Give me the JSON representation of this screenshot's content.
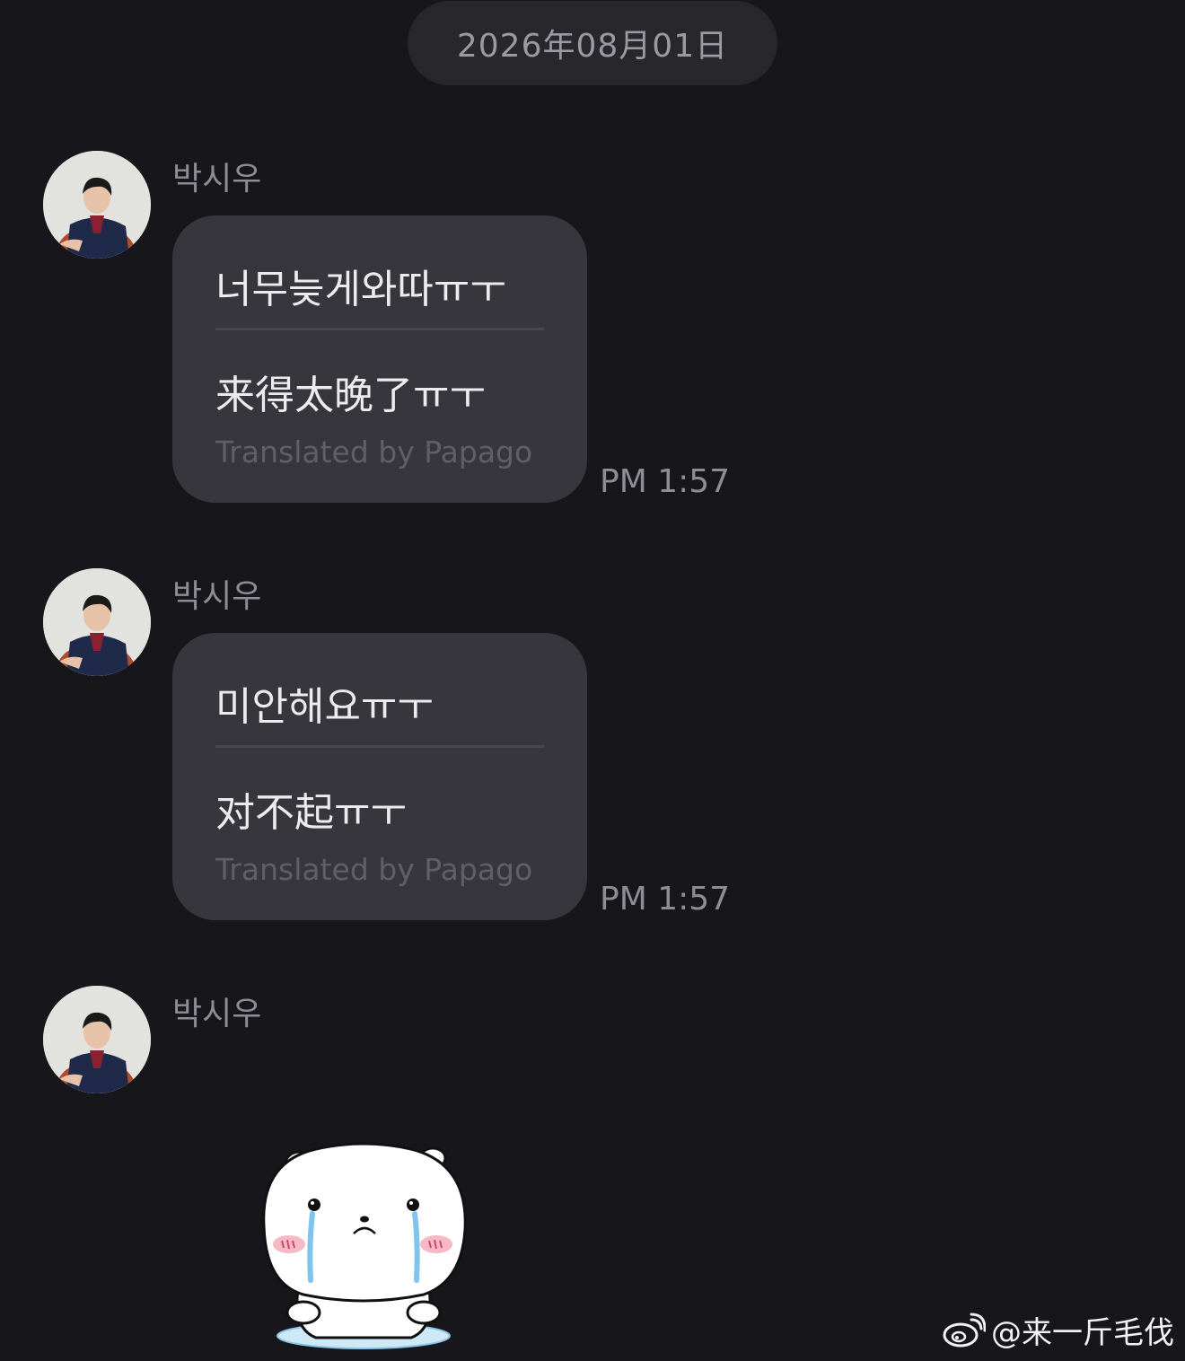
{
  "chat": {
    "date": "2026年08月01日",
    "messages": [
      {
        "sender": "박시우",
        "original": "너무늦게와따ㅠㅜ",
        "translation": "来得太晚了ㅠㅜ",
        "translated_by": "Translated by Papago",
        "time": "PM 1:57"
      },
      {
        "sender": "박시우",
        "original": "미안해요ㅠㅜ",
        "translation": "对不起ㅠㅜ",
        "translated_by": "Translated by Papago",
        "time": "PM 1:57"
      },
      {
        "sender": "박시우",
        "sticker": "crying-white-bear-sticker"
      }
    ]
  },
  "watermark": {
    "text": "@来一斤毛伐",
    "icon": "weibo-icon"
  },
  "colors": {
    "background": "#17171b",
    "bubble": "#36363c",
    "date_pill": "#27272c",
    "muted_text": "#8d8d93"
  }
}
